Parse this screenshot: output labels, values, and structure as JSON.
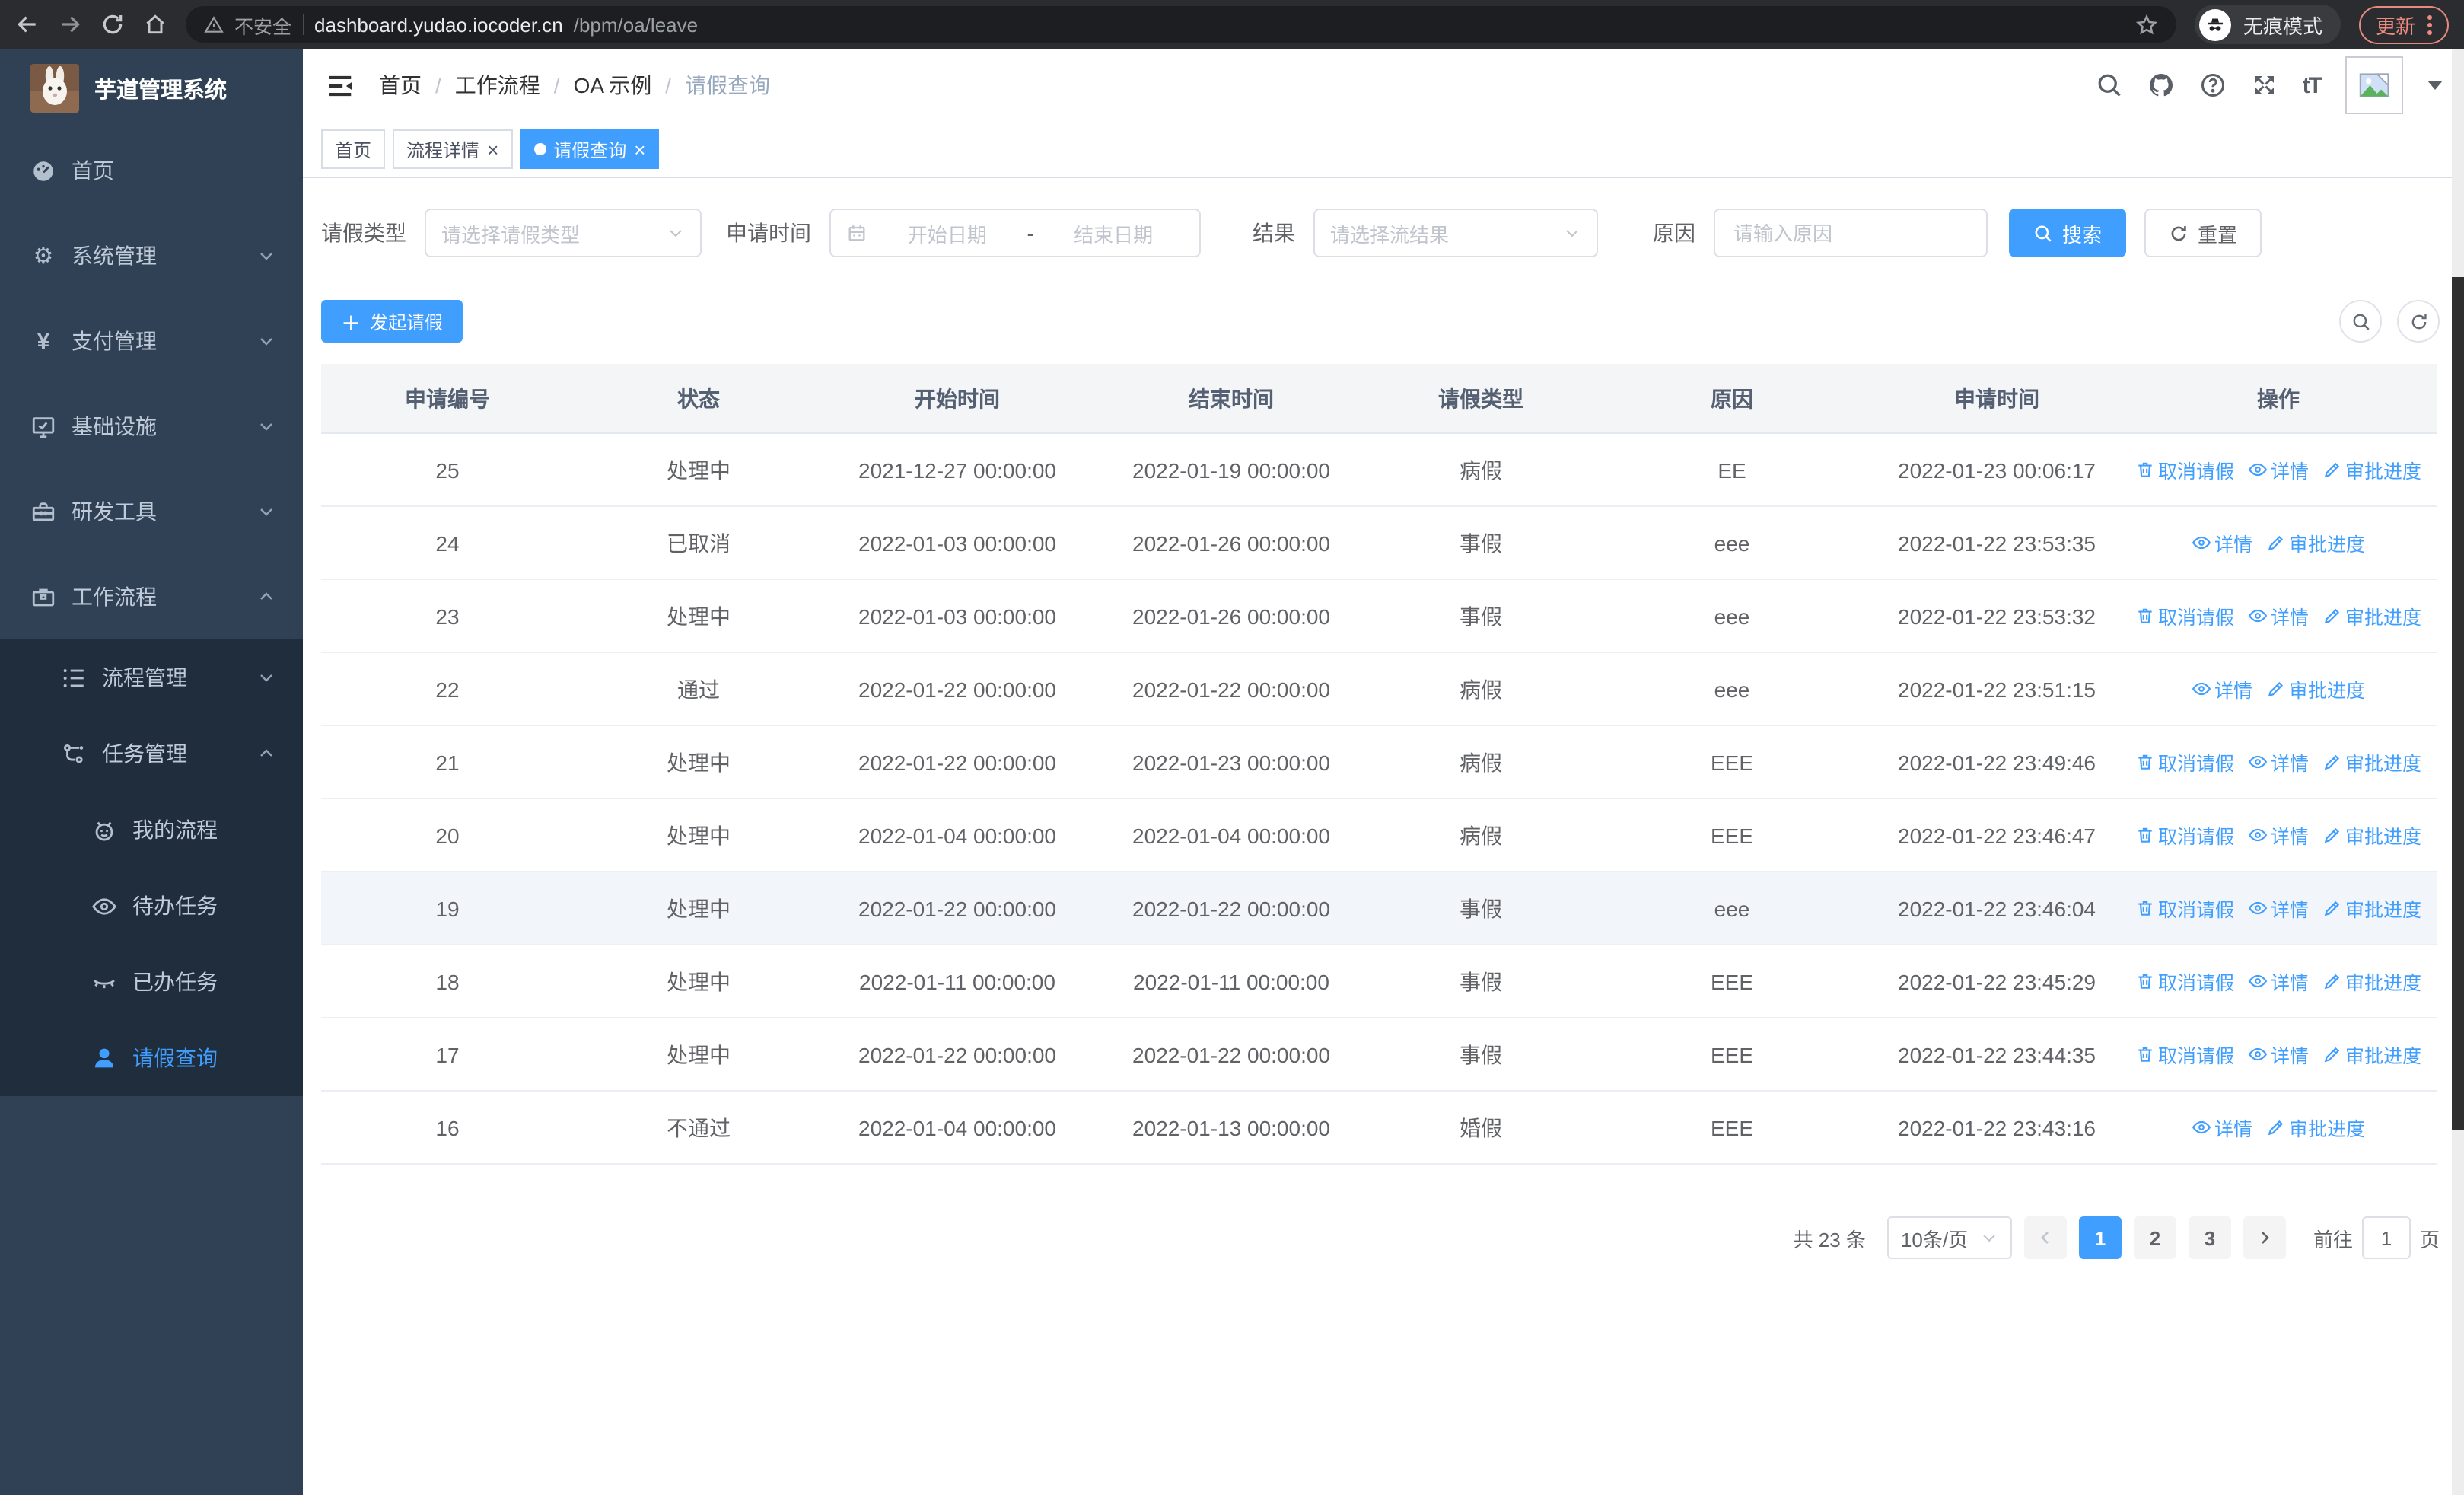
{
  "browser": {
    "security_label": "不安全",
    "url_host": "dashboard.yudao.iocoder.cn",
    "url_path": "/bpm/oa/leave",
    "incognito_label": "无痕模式",
    "update_label": "更新"
  },
  "sidebar": {
    "title": "芋道管理系统",
    "items": [
      {
        "label": "首页"
      },
      {
        "label": "系统管理"
      },
      {
        "label": "支付管理"
      },
      {
        "label": "基础设施"
      },
      {
        "label": "研发工具"
      },
      {
        "label": "工作流程"
      },
      {
        "label": "流程管理"
      },
      {
        "label": "任务管理"
      },
      {
        "label": "我的流程"
      },
      {
        "label": "待办任务"
      },
      {
        "label": "已办任务"
      },
      {
        "label": "请假查询"
      }
    ]
  },
  "breadcrumb": [
    "首页",
    "工作流程",
    "OA 示例",
    "请假查询"
  ],
  "tabs": [
    {
      "label": "首页"
    },
    {
      "label": "流程详情"
    },
    {
      "label": "请假查询"
    }
  ],
  "filters": {
    "leave_type_label": "请假类型",
    "leave_type_placeholder": "请选择请假类型",
    "apply_time_label": "申请时间",
    "start_date_placeholder": "开始日期",
    "date_separator": "-",
    "end_date_placeholder": "结束日期",
    "result_label": "结果",
    "result_placeholder": "请选择流结果",
    "reason_label": "原因",
    "reason_placeholder": "请输入原因",
    "search_label": "搜索",
    "reset_label": "重置"
  },
  "toolbar": {
    "create_label": "发起请假"
  },
  "table": {
    "headers": [
      "申请编号",
      "状态",
      "开始时间",
      "结束时间",
      "请假类型",
      "原因",
      "申请时间",
      "操作"
    ],
    "action_labels": {
      "cancel": "取消请假",
      "detail": "详情",
      "progress": "审批进度"
    },
    "rows": [
      {
        "id": "25",
        "status": "处理中",
        "start": "2021-12-27 00:00:00",
        "end": "2022-01-19 00:00:00",
        "type": "病假",
        "reason": "EE",
        "apply": "2022-01-23 00:06:17",
        "can_cancel": true,
        "highlight": false
      },
      {
        "id": "24",
        "status": "已取消",
        "start": "2022-01-03 00:00:00",
        "end": "2022-01-26 00:00:00",
        "type": "事假",
        "reason": "eee",
        "apply": "2022-01-22 23:53:35",
        "can_cancel": false,
        "highlight": false
      },
      {
        "id": "23",
        "status": "处理中",
        "start": "2022-01-03 00:00:00",
        "end": "2022-01-26 00:00:00",
        "type": "事假",
        "reason": "eee",
        "apply": "2022-01-22 23:53:32",
        "can_cancel": true,
        "highlight": false
      },
      {
        "id": "22",
        "status": "通过",
        "start": "2022-01-22 00:00:00",
        "end": "2022-01-22 00:00:00",
        "type": "病假",
        "reason": "eee",
        "apply": "2022-01-22 23:51:15",
        "can_cancel": false,
        "highlight": false
      },
      {
        "id": "21",
        "status": "处理中",
        "start": "2022-01-22 00:00:00",
        "end": "2022-01-23 00:00:00",
        "type": "病假",
        "reason": "EEE",
        "apply": "2022-01-22 23:49:46",
        "can_cancel": true,
        "highlight": false
      },
      {
        "id": "20",
        "status": "处理中",
        "start": "2022-01-04 00:00:00",
        "end": "2022-01-04 00:00:00",
        "type": "病假",
        "reason": "EEE",
        "apply": "2022-01-22 23:46:47",
        "can_cancel": true,
        "highlight": false
      },
      {
        "id": "19",
        "status": "处理中",
        "start": "2022-01-22 00:00:00",
        "end": "2022-01-22 00:00:00",
        "type": "事假",
        "reason": "eee",
        "apply": "2022-01-22 23:46:04",
        "can_cancel": true,
        "highlight": true
      },
      {
        "id": "18",
        "status": "处理中",
        "start": "2022-01-11 00:00:00",
        "end": "2022-01-11 00:00:00",
        "type": "事假",
        "reason": "EEE",
        "apply": "2022-01-22 23:45:29",
        "can_cancel": true,
        "highlight": false
      },
      {
        "id": "17",
        "status": "处理中",
        "start": "2022-01-22 00:00:00",
        "end": "2022-01-22 00:00:00",
        "type": "事假",
        "reason": "EEE",
        "apply": "2022-01-22 23:44:35",
        "can_cancel": true,
        "highlight": false
      },
      {
        "id": "16",
        "status": "不通过",
        "start": "2022-01-04 00:00:00",
        "end": "2022-01-13 00:00:00",
        "type": "婚假",
        "reason": "EEE",
        "apply": "2022-01-22 23:43:16",
        "can_cancel": false,
        "highlight": false
      }
    ]
  },
  "pagination": {
    "total_label": "共 23 条",
    "page_size": "10条/页",
    "pages": [
      "1",
      "2",
      "3"
    ],
    "current_page": "1",
    "goto_label": "前往",
    "goto_value": "1",
    "page_unit": "页"
  },
  "colors": {
    "accent": "#409eff",
    "sidebar_bg": "#304156",
    "submenu_bg": "#1f2d3d",
    "sidebar_text": "#bfcbd9",
    "update_pill": "#ee8a7f",
    "table_header_bg": "#f3f5f7"
  }
}
